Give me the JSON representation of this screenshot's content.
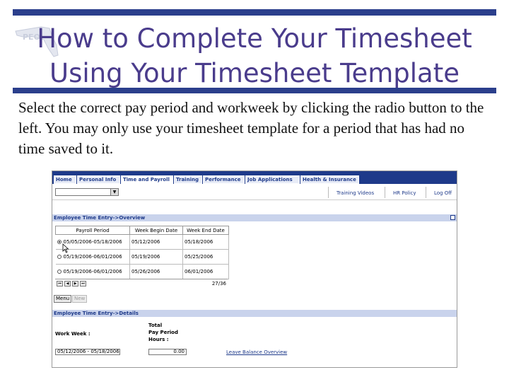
{
  "slide": {
    "title_line1": "How to Complete Your Timesheet",
    "title_line2": "Using Your Timesheet Template",
    "body": "Select the correct pay period and workweek by clicking the radio button to the left. You may only use your timesheet template for a period that has had no time saved to it."
  },
  "colors": {
    "accent": "#2b3f8c",
    "title": "#4a3c8c",
    "nav": "#1e3a8a"
  },
  "app": {
    "tabs": [
      {
        "label": "Home"
      },
      {
        "label": "Personal Info"
      },
      {
        "label": "Time and Payroll"
      },
      {
        "label": "Training"
      },
      {
        "label": "Performance"
      },
      {
        "label": "Job Applications"
      },
      {
        "label": "Health & Insurance"
      }
    ],
    "links": {
      "training_videos": "Training Videos",
      "hr_policy": "HR Policy",
      "log_off": "Log Off"
    },
    "overview_title": "Employee Time Entry->Overview",
    "details_title": "Employee Time Entry->Details",
    "columns": [
      "Payroll Period",
      "Week Begin Date",
      "Week End Date"
    ],
    "rows": [
      {
        "period": "05/05/2006-05/18/2006",
        "begin": "05/12/2006",
        "end": "05/18/2006",
        "selected": true
      },
      {
        "period": "05/19/2006-06/01/2006",
        "begin": "05/19/2006",
        "end": "05/25/2006",
        "selected": false
      },
      {
        "period": "05/19/2006-06/01/2006",
        "begin": "05/26/2006",
        "end": "06/01/2006",
        "selected": false
      }
    ],
    "pager_count": "27/36",
    "menu_label": "Menu",
    "new_label": "New",
    "work_week_label": "Work Week :",
    "total_label_1": "Total",
    "total_label_2": "Pay Period",
    "total_label_3": "Hours :",
    "work_week_value": "05/12/2006 - 05/18/2006",
    "hours_value": "0.00",
    "leave_link": "Leave Balance Overview"
  }
}
